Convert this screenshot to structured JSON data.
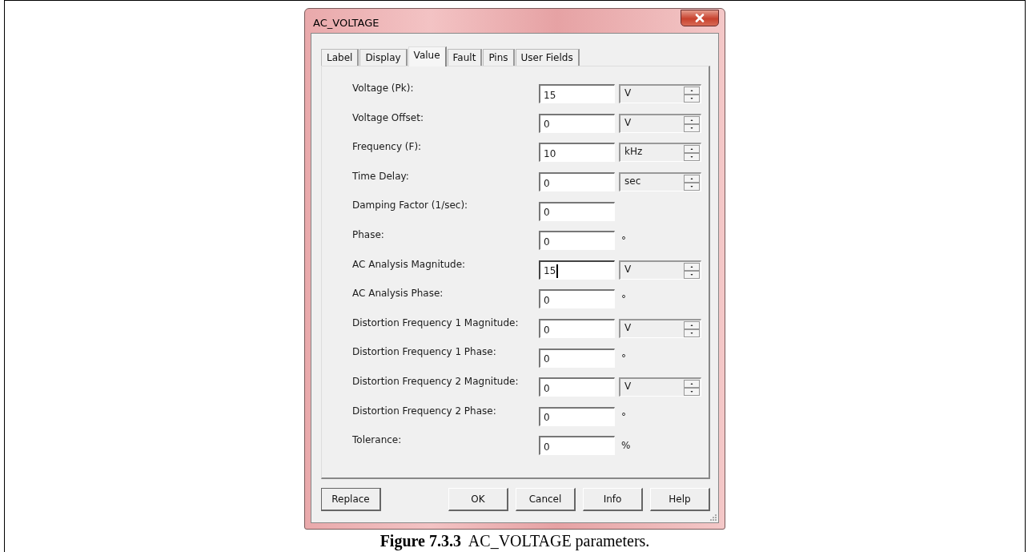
{
  "window": {
    "title": "AC_VOLTAGE"
  },
  "tabs": [
    {
      "label": "Label",
      "selected": false
    },
    {
      "label": "Display",
      "selected": false
    },
    {
      "label": "Value",
      "selected": true
    },
    {
      "label": "Fault",
      "selected": false
    },
    {
      "label": "Pins",
      "selected": false
    },
    {
      "label": "User Fields",
      "selected": false
    }
  ],
  "fields": [
    {
      "label": "Voltage (Pk):",
      "value": "15",
      "focused": false,
      "unit": {
        "kind": "spinner",
        "text": "V"
      }
    },
    {
      "label": "Voltage Offset:",
      "value": "0",
      "focused": false,
      "unit": {
        "kind": "spinner",
        "text": "V"
      }
    },
    {
      "label": "Frequency (F):",
      "value": "10",
      "focused": false,
      "unit": {
        "kind": "spinner",
        "text": "kHz"
      }
    },
    {
      "label": "Time Delay:",
      "value": "0",
      "focused": false,
      "unit": {
        "kind": "spinner",
        "text": "sec"
      }
    },
    {
      "label": "Damping Factor (1/sec):",
      "value": "0",
      "focused": false,
      "unit": {
        "kind": "none"
      }
    },
    {
      "label": "Phase:",
      "value": "0",
      "focused": false,
      "unit": {
        "kind": "text",
        "text": "°"
      }
    },
    {
      "label": "AC Analysis Magnitude:",
      "value": "15",
      "focused": true,
      "unit": {
        "kind": "spinner",
        "text": "V"
      }
    },
    {
      "label": "AC Analysis Phase:",
      "value": "0",
      "focused": false,
      "unit": {
        "kind": "text",
        "text": "°"
      }
    },
    {
      "label": "Distortion Frequency 1 Magnitude:",
      "value": "0",
      "focused": false,
      "unit": {
        "kind": "spinner",
        "text": "V"
      }
    },
    {
      "label": "Distortion Frequency 1 Phase:",
      "value": "0",
      "focused": false,
      "unit": {
        "kind": "text",
        "text": "°"
      }
    },
    {
      "label": "Distortion Frequency 2 Magnitude:",
      "value": "0",
      "focused": false,
      "unit": {
        "kind": "spinner",
        "text": "V"
      }
    },
    {
      "label": "Distortion Frequency 2 Phase:",
      "value": "0",
      "focused": false,
      "unit": {
        "kind": "text",
        "text": "°"
      }
    },
    {
      "label": "Tolerance:",
      "value": "0",
      "focused": false,
      "unit": {
        "kind": "text",
        "text": "%"
      }
    }
  ],
  "buttons": [
    {
      "label": "Replace",
      "kind": "left"
    },
    {
      "label": "OK",
      "kind": "right"
    },
    {
      "label": "Cancel",
      "kind": "right"
    },
    {
      "label": "Info",
      "kind": "right"
    },
    {
      "label": "Help",
      "kind": "right"
    }
  ],
  "caption": "**Figure 7.3.3**  AC_VOLTAGE parameters."
}
